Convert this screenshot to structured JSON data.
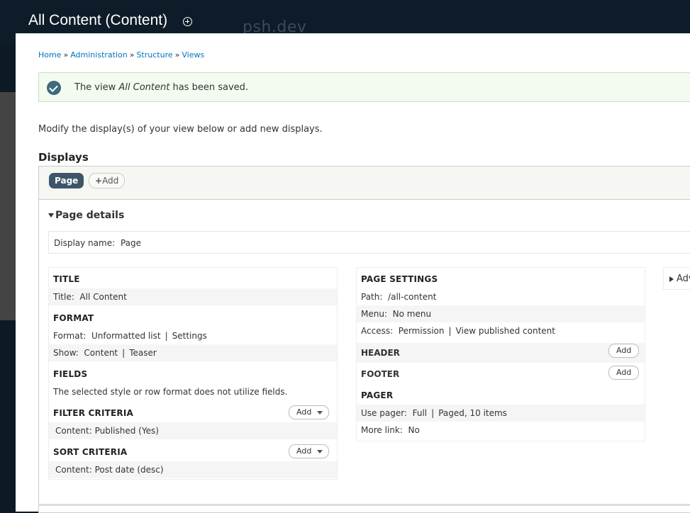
{
  "header": {
    "title": "All Content (Content)",
    "site": "psh.dev"
  },
  "breadcrumb": [
    "Home",
    "Administration",
    "Structure",
    "Views"
  ],
  "status": {
    "prefix": "The view ",
    "view_name": "All Content",
    "suffix": " has been saved."
  },
  "intro": "Modify the display(s) of your view below or add new displays.",
  "displays": {
    "heading": "Displays",
    "tab_active": "Page",
    "tab_add": "Add"
  },
  "details": {
    "heading": "Page details",
    "display_name_label": "Display name:",
    "display_name_value": "Page"
  },
  "left": {
    "title": {
      "heading": "TITLE",
      "label": "Title:",
      "value": "All Content"
    },
    "format": {
      "heading": "FORMAT",
      "format_label": "Format:",
      "format_value": "Unformatted list",
      "format_settings": "Settings",
      "show_label": "Show:",
      "show_value": "Content",
      "show_mode": "Teaser"
    },
    "fields": {
      "heading": "FIELDS",
      "note": "The selected style or row format does not utilize fields."
    },
    "filter": {
      "heading": "FILTER CRITERIA",
      "add": "Add",
      "item": "Content: Published (Yes)"
    },
    "sort": {
      "heading": "SORT CRITERIA",
      "add": "Add",
      "item": "Content: Post date (desc)"
    }
  },
  "mid": {
    "page_settings": {
      "heading": "PAGE SETTINGS",
      "path_label": "Path:",
      "path_value": "/all-content",
      "menu_label": "Menu:",
      "menu_value": "No menu",
      "access_label": "Access:",
      "access_value": "Permission",
      "access_perm": "View published content"
    },
    "header": {
      "heading": "HEADER",
      "add": "Add"
    },
    "footer": {
      "heading": "FOOTER",
      "add": "Add"
    },
    "pager": {
      "heading": "PAGER",
      "use_label": "Use pager:",
      "use_value": "Full",
      "use_detail": "Paged, 10 items",
      "more_label": "More link:",
      "more_value": "No"
    }
  },
  "advanced": "Adv"
}
